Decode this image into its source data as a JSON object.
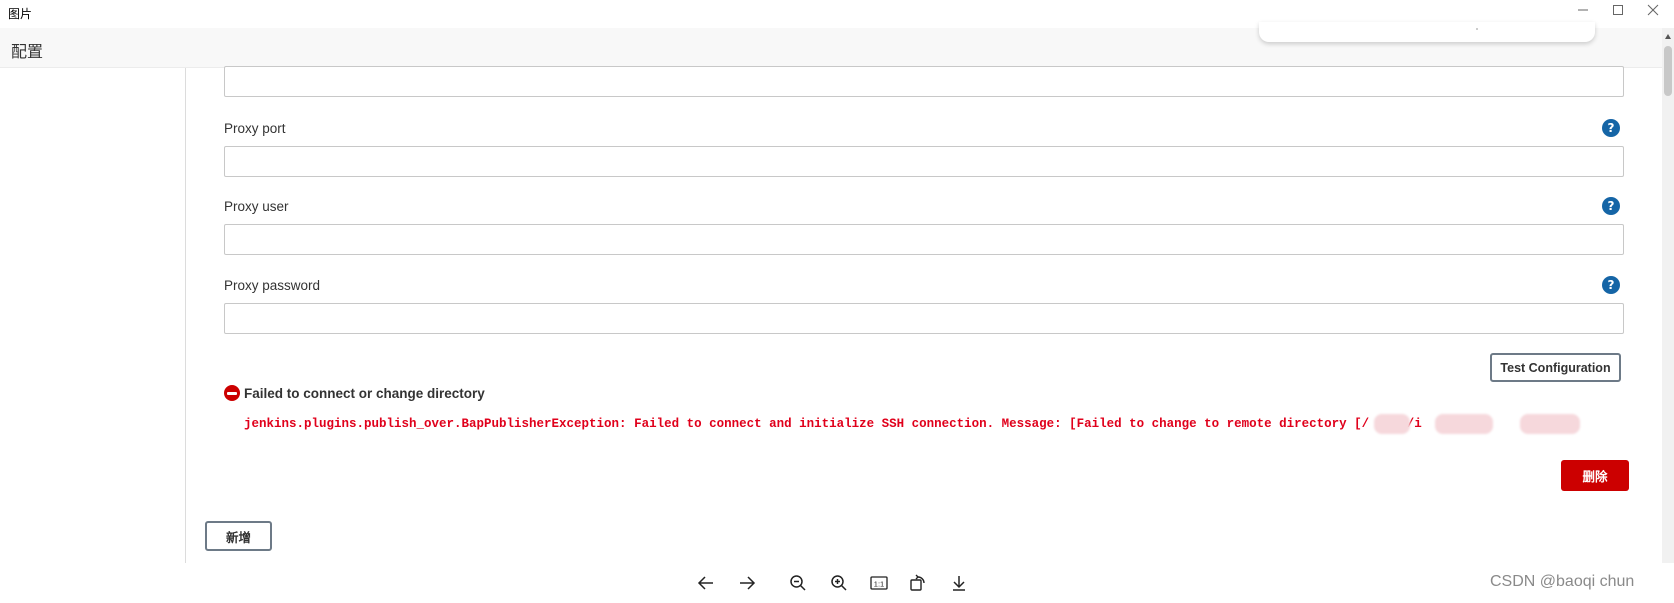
{
  "window": {
    "title": "图片",
    "icons": {
      "minimize": "minimize-icon",
      "maximize": "maximize-icon",
      "close": "close-icon"
    }
  },
  "page": {
    "title": "配置"
  },
  "form": {
    "fields": [
      {
        "label": "Proxy port",
        "value": ""
      },
      {
        "label": "Proxy user",
        "value": ""
      },
      {
        "label": "Proxy password",
        "value": ""
      }
    ],
    "help_glyph": "?",
    "test_button": "Test Configuration",
    "error": {
      "title": "Failed to connect or change directory",
      "detail": "jenkins.plugins.publish_over.BapPublisherException: Failed to connect and initialize SSH connection. Message: [Failed to change to remote directory [/    h/i      e/a      n]]"
    },
    "delete_button": "删除",
    "add_button": "新增"
  },
  "toolbar": {
    "icons": [
      "arrow-left-icon",
      "arrow-right-icon",
      "zoom-out-icon",
      "zoom-in-icon",
      "actual-size-icon",
      "rotate-icon",
      "download-icon"
    ],
    "actual_size_label": "1:1",
    "watermark": "CSDN @baoqi chun"
  },
  "colors": {
    "error_red": "#e0001b",
    "delete_button": "#cc0000",
    "help_blue": "#1565a6"
  }
}
